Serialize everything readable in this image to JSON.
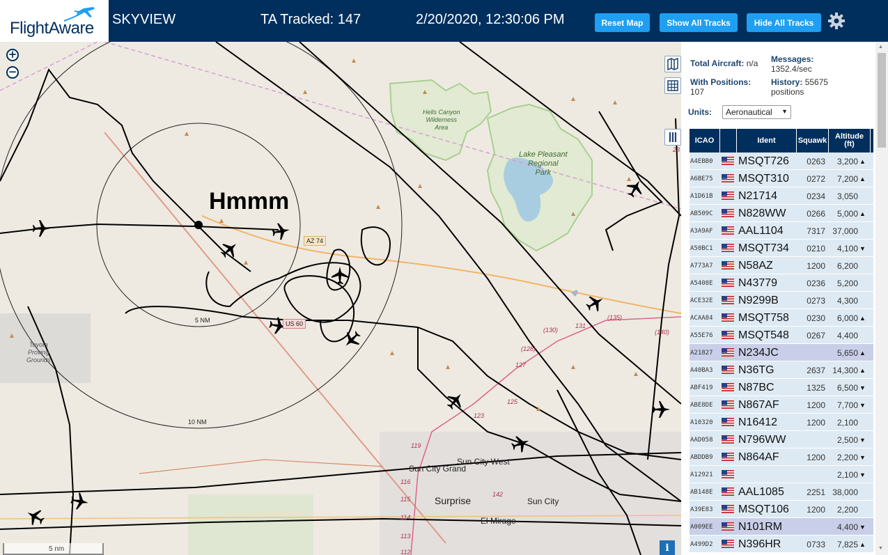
{
  "header": {
    "logo_text": "FlightAware",
    "site_name": "SKYVIEW",
    "tracked": "TA Tracked: 147",
    "datetime": "2/20/2020, 12:30:06 PM",
    "buttons": {
      "reset": "Reset Map",
      "show_all": "Show All Tracks",
      "hide_all": "Hide All Tracks"
    },
    "settings_icon": "gear-icon"
  },
  "map": {
    "zoom_in": "+",
    "zoom_out": "−",
    "annotation": "Hmmm",
    "labels": {
      "hells_canyon": [
        "Hells Canyon",
        "Wilderness",
        "Area"
      ],
      "lake_pleasant": [
        "Lake Pleasant",
        "Regional",
        "Park"
      ],
      "toyota": [
        "Toyota",
        "Proving",
        "Grounds"
      ],
      "az74": "AZ 74",
      "us60": "US 60",
      "sun_city_grand": "Sun City Grand",
      "sun_city_west": "Sun City West",
      "surprise": "Surprise",
      "sun_city": "Sun City",
      "el_mirage": "El Mirage",
      "ring_10nm": "10 NM",
      "ring_5nm": "5 NM",
      "road_128": "(128)",
      "road_130": "(130)",
      "road_131": "131",
      "road_135": "(135)",
      "road_140": "(140)",
      "road_127": "127",
      "road_125": "125",
      "road_123": "123",
      "road_119": "119",
      "road_116": "116",
      "road_115": "115",
      "road_114": "114",
      "road_113": "113",
      "road_112": "112",
      "road_142": "142",
      "road_23": "23"
    },
    "scale": "5 nm",
    "info": "i"
  },
  "sidebar": {
    "total_aircraft_label": "Total Aircraft:",
    "total_aircraft_value": "n/a",
    "messages_label": "Messages:",
    "messages_value": "1352.4/sec",
    "with_positions_label": "With Positions:",
    "with_positions_value": "107",
    "history_label": "History:",
    "history_value": "55675",
    "history_unit": "positions",
    "units_label": "Units:",
    "units_value": "Aeronautical",
    "columns": {
      "icao": "ICAO",
      "ident": "Ident",
      "squawk": "Squawk",
      "altitude": "Altitude",
      "altitude_unit": "(ft)"
    },
    "rows": [
      {
        "icao": "A4EBB0",
        "ident": "MSQT726",
        "squawk": "0263",
        "alt": "3,200",
        "trend": "▲"
      },
      {
        "icao": "A6BE75",
        "ident": "MSQT310",
        "squawk": "0272",
        "alt": "7,200",
        "trend": "▲"
      },
      {
        "icao": "A1D61B",
        "ident": "N21714",
        "squawk": "0234",
        "alt": "3,050",
        "trend": ""
      },
      {
        "icao": "AB509C",
        "ident": "N828WW",
        "squawk": "0266",
        "alt": "5,000",
        "trend": "▲"
      },
      {
        "icao": "A3A9AF",
        "ident": "AAL1104",
        "squawk": "7317",
        "alt": "37,000",
        "trend": ""
      },
      {
        "icao": "A50BC1",
        "ident": "MSQT734",
        "squawk": "0210",
        "alt": "4,100",
        "trend": "▼"
      },
      {
        "icao": "A773A7",
        "ident": "N58AZ",
        "squawk": "1200",
        "alt": "6,200",
        "trend": ""
      },
      {
        "icao": "A5408E",
        "ident": "N43779",
        "squawk": "0236",
        "alt": "5,200",
        "trend": ""
      },
      {
        "icao": "ACE32E",
        "ident": "N9299B",
        "squawk": "0273",
        "alt": "4,300",
        "trend": ""
      },
      {
        "icao": "ACAA84",
        "ident": "MSQT758",
        "squawk": "0230",
        "alt": "6,000",
        "trend": "▲"
      },
      {
        "icao": "A55E76",
        "ident": "MSQT548",
        "squawk": "0267",
        "alt": "4,400",
        "trend": ""
      },
      {
        "icao": "A21827",
        "ident": "N234JC",
        "squawk": "",
        "alt": "5,650",
        "trend": "▲",
        "selected": true
      },
      {
        "icao": "A40BA3",
        "ident": "N36TG",
        "squawk": "2637",
        "alt": "14,300",
        "trend": "▲"
      },
      {
        "icao": "ABF419",
        "ident": "N87BC",
        "squawk": "1325",
        "alt": "6,500",
        "trend": "▼"
      },
      {
        "icao": "ABE8DE",
        "ident": "N867AF",
        "squawk": "1200",
        "alt": "7,700",
        "trend": "▼"
      },
      {
        "icao": "A10320",
        "ident": "N16412",
        "squawk": "1200",
        "alt": "2,100",
        "trend": ""
      },
      {
        "icao": "AAD058",
        "ident": "N796WW",
        "squawk": "",
        "alt": "2,500",
        "trend": "▼"
      },
      {
        "icao": "ABDDB9",
        "ident": "N864AF",
        "squawk": "1200",
        "alt": "2,200",
        "trend": "▼"
      },
      {
        "icao": "A12921",
        "ident": "",
        "squawk": "",
        "alt": "2,100",
        "trend": "▼"
      },
      {
        "icao": "AB148E",
        "ident": "AAL1085",
        "squawk": "2251",
        "alt": "38,000",
        "trend": ""
      },
      {
        "icao": "A39E83",
        "ident": "MSQT106",
        "squawk": "1200",
        "alt": "2,200",
        "trend": ""
      },
      {
        "icao": "A009EE",
        "ident": "N101RM",
        "squawk": "",
        "alt": "4,400",
        "trend": "▼",
        "selected": true
      },
      {
        "icao": "A499D2",
        "ident": "N396HR",
        "squawk": "0733",
        "alt": "7,825",
        "trend": "▲"
      }
    ]
  }
}
